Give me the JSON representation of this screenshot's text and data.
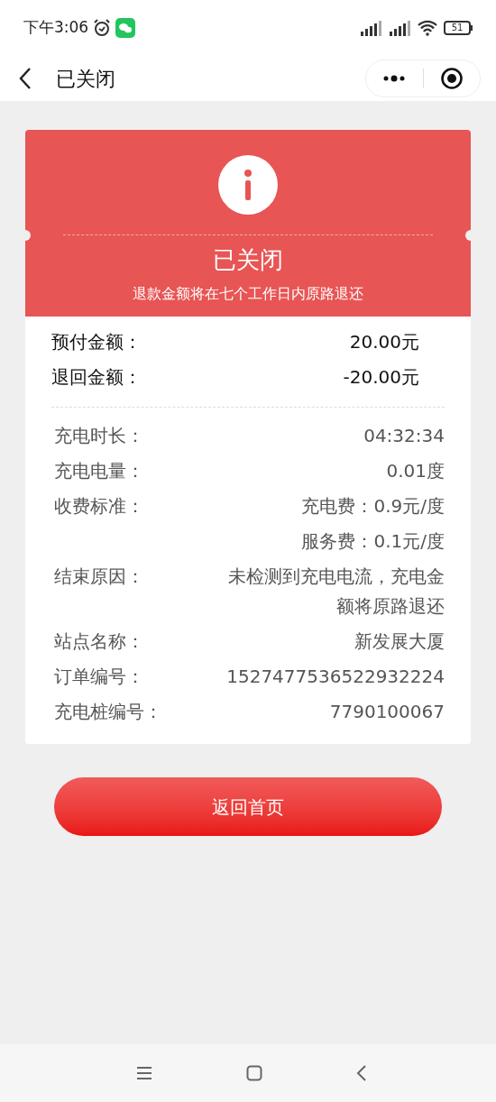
{
  "status_bar": {
    "time": "下午3:06",
    "battery": "51"
  },
  "nav": {
    "title": "已关闭"
  },
  "header": {
    "title": "已关闭",
    "subtitle": "退款金额将在七个工作日内原路退还"
  },
  "amounts": [
    {
      "label": "预付金额：",
      "value": "20.00元"
    },
    {
      "label": "退回金额：",
      "value": "-20.00元"
    }
  ],
  "details": [
    {
      "label": "充电时长：",
      "values": [
        "04:32:34"
      ]
    },
    {
      "label": "充电电量：",
      "values": [
        "0.01度"
      ]
    },
    {
      "label": "收费标准：",
      "values": [
        "充电费：0.9元/度",
        "服务费：0.1元/度"
      ]
    },
    {
      "label": "结束原因：",
      "values": [
        "未检测到充电电流，充电金额将原路退还"
      ]
    },
    {
      "label": "站点名称：",
      "values": [
        "新发展大厦"
      ]
    },
    {
      "label": "订单编号：",
      "values": [
        "1527477536522932224"
      ]
    },
    {
      "label": "充电桩编号：",
      "values": [
        "7790100067"
      ]
    }
  ],
  "button": "返回首页"
}
